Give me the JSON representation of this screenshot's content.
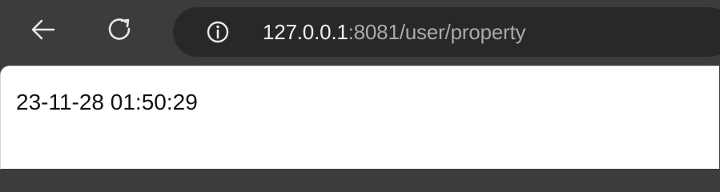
{
  "browser": {
    "address_bar": {
      "url_host": "127.0.0.1",
      "url_rest": ":8081/user/property"
    },
    "icons": {
      "back": "back-arrow-icon",
      "reload": "reload-icon",
      "site_info": "info-icon"
    },
    "colors": {
      "toolbar_bg": "#3c3c3c",
      "omnibox_bg": "#282828",
      "url_host": "#f1f1f1",
      "url_rest": "#a9a9a9"
    }
  },
  "page": {
    "content_text": "23-11-28 01:50:29"
  }
}
